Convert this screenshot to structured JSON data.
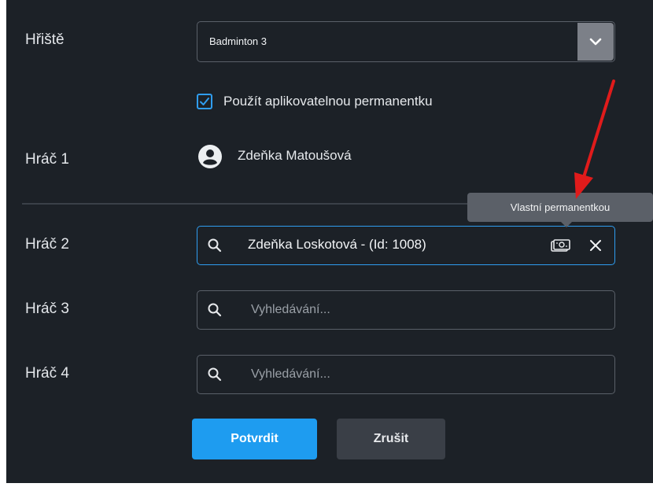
{
  "court": {
    "label": "Hřiště",
    "selected": "Badminton 3",
    "dropdown_icon": "chevron-down-icon"
  },
  "pass_option": {
    "label": "Použít aplikovatelnou permanentku",
    "checked": true
  },
  "players": [
    {
      "label": "Hráč 1",
      "name": "Zdeňka Matoušová",
      "icon": "user-avatar-icon"
    },
    {
      "label": "Hráč 2",
      "value": "Zdeňka Loskotová -  (Id: 1008)",
      "icon": "search-icon",
      "badge_icon": "ticket-icon",
      "clear_icon": "close-icon"
    },
    {
      "label": "Hráč 3",
      "placeholder": "Vyhledávání...",
      "icon": "search-icon"
    },
    {
      "label": "Hráč 4",
      "placeholder": "Vyhledávání...",
      "icon": "search-icon"
    }
  ],
  "tooltip": {
    "text": "Vlastní permanentkou"
  },
  "buttons": {
    "confirm": "Potvrdit",
    "cancel": "Zrušit"
  },
  "colors": {
    "background": "#1c2127",
    "accent": "#1e9cf0",
    "annotation_arrow": "#e01b1b"
  }
}
